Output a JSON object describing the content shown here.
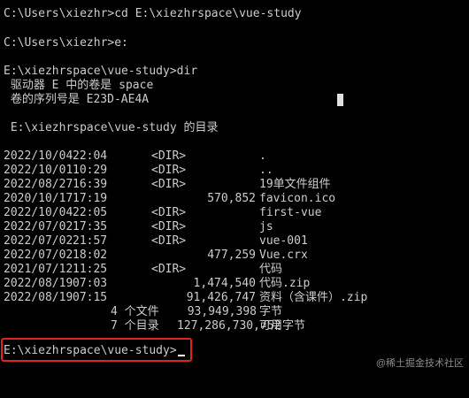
{
  "terminal": {
    "lines": {
      "l1": "C:\\Users\\xiezhr>cd E:\\xiezhrspace\\vue-study",
      "l2": "C:\\Users\\xiezhr>e:",
      "l3": "E:\\xiezhrspace\\vue-study>dir",
      "l4": " 驱动器 E 中的卷是 space",
      "l5": " 卷的序列号是 E23D-AE4A",
      "l6": " E:\\xiezhrspace\\vue-study 的目录"
    },
    "listing": [
      {
        "date": "2022/10/04",
        "time": "22:04",
        "dir": "<DIR>",
        "size": "",
        "name": "."
      },
      {
        "date": "2022/10/01",
        "time": "10:29",
        "dir": "<DIR>",
        "size": "",
        "name": ".."
      },
      {
        "date": "2022/08/27",
        "time": "16:39",
        "dir": "<DIR>",
        "size": "",
        "name": "19单文件组件"
      },
      {
        "date": "2020/10/17",
        "time": "17:19",
        "dir": "",
        "size": "570,852",
        "name": "favicon.ico"
      },
      {
        "date": "2022/10/04",
        "time": "22:05",
        "dir": "<DIR>",
        "size": "",
        "name": "first-vue"
      },
      {
        "date": "2022/07/02",
        "time": "17:35",
        "dir": "<DIR>",
        "size": "",
        "name": "js"
      },
      {
        "date": "2022/07/02",
        "time": "21:57",
        "dir": "<DIR>",
        "size": "",
        "name": "vue-001"
      },
      {
        "date": "2022/07/02",
        "time": "18:02",
        "dir": "",
        "size": "477,259",
        "name": "Vue.crx"
      },
      {
        "date": "2021/07/12",
        "time": "11:25",
        "dir": "<DIR>",
        "size": "",
        "name": "代码"
      },
      {
        "date": "2022/08/19",
        "time": "07:03",
        "dir": "",
        "size": "1,474,540",
        "name": "代码.zip"
      },
      {
        "date": "2022/08/19",
        "time": "07:15",
        "dir": "",
        "size": "91,426,747",
        "name": "资料（含课件）.zip"
      }
    ],
    "summary": {
      "files_count": "4 个文件",
      "files_size": "93,949,398",
      "files_unit": "字节",
      "dirs_count": "7 个目录",
      "dirs_size": "127,286,730,752",
      "dirs_unit": "可用字节"
    },
    "prompt": "E:\\xiezhrspace\\vue-study>"
  },
  "watermark": "@稀土掘金技术社区",
  "colors": {
    "background": "#000000",
    "text": "#cccccc",
    "highlight_border": "#e0241b"
  }
}
